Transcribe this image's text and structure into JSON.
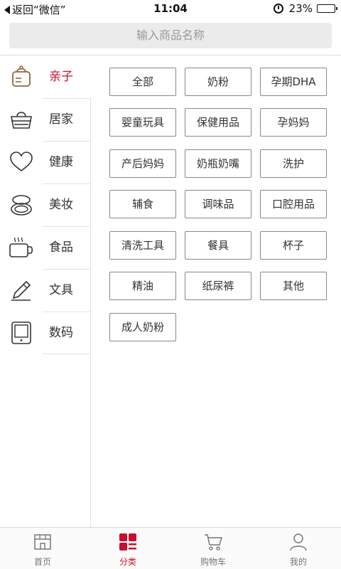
{
  "status_bar": {
    "back_label": "返回“微信”",
    "time": "11:04",
    "battery_text": "23%",
    "battery_level": 0.23
  },
  "search": {
    "placeholder": "输入商品名称"
  },
  "sidebar": {
    "items": [
      {
        "label": "亲子",
        "icon": "baby-bag-icon",
        "active": true
      },
      {
        "label": "居家",
        "icon": "basket-icon",
        "active": false
      },
      {
        "label": "健康",
        "icon": "heart-icon",
        "active": false
      },
      {
        "label": "美妆",
        "icon": "compact-icon",
        "active": false
      },
      {
        "label": "食品",
        "icon": "cup-icon",
        "active": false
      },
      {
        "label": "文具",
        "icon": "pencil-icon",
        "active": false
      },
      {
        "label": "数码",
        "icon": "tablet-icon",
        "active": false
      }
    ]
  },
  "subcategories": [
    "全部",
    "奶粉",
    "孕期DHA",
    "婴童玩具",
    "保健用品",
    "孕妈妈",
    "产后妈妈",
    "奶瓶奶嘴",
    "洗护",
    "辅食",
    "调味品",
    "口腔用品",
    "清洗工具",
    "餐具",
    "杯子",
    "精油",
    "纸尿裤",
    "其他",
    "成人奶粉"
  ],
  "tabbar": {
    "tabs": [
      {
        "label": "首页",
        "icon": "store-icon",
        "active": false
      },
      {
        "label": "分类",
        "icon": "category-grid-icon",
        "active": true
      },
      {
        "label": "购物车",
        "icon": "cart-icon",
        "active": false
      },
      {
        "label": "我的",
        "icon": "user-icon",
        "active": false
      }
    ]
  },
  "colors": {
    "accent": "#c8102e",
    "icon_brown": "#8b6a3e",
    "text": "#333333",
    "border": "#888888"
  }
}
